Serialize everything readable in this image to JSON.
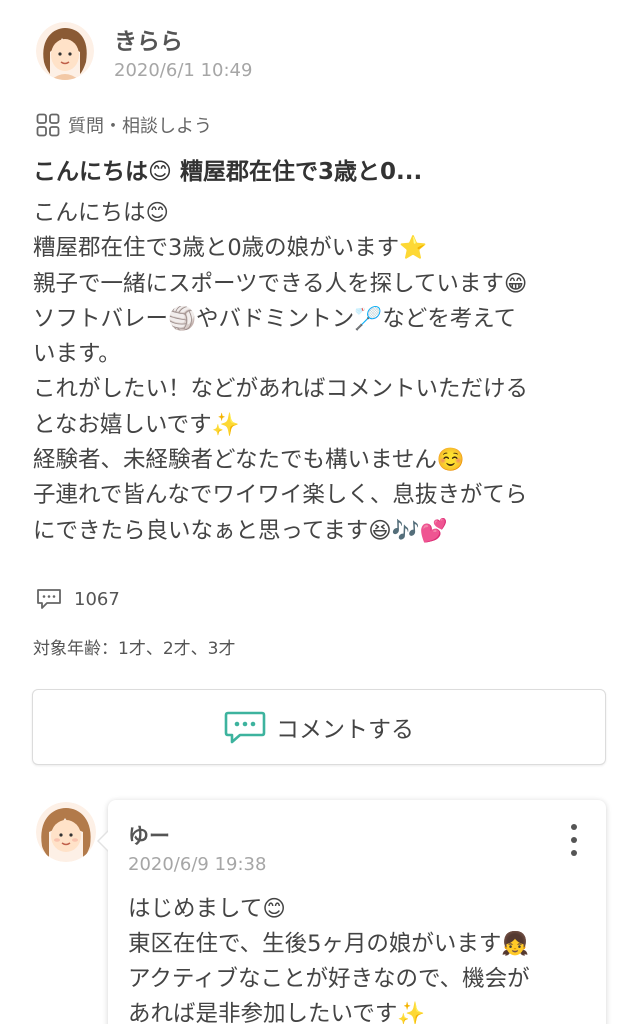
{
  "post": {
    "author": "きらら",
    "date": "2020/6/1 10:49",
    "category": "質問・相談しよう",
    "title": "こんにちは😊 糟屋郡在住で3歳と0...",
    "body_lines": [
      "こんにちは😊",
      "糟屋郡在住で3歳と0歳の娘がいます⭐",
      "親子で一緒にスポーツできる人を探しています😁",
      "ソフトバレー🏐やバドミントン🏸などを考えて",
      "います。",
      "これがしたい！などがあればコメントいただける",
      "となお嬉しいです✨",
      "経験者、未経験者どなたでも構いません☺️",
      "子連れで皆んなでワイワイ楽しく、息抜きがてら",
      "にできたら良いなぁと思ってます😆🎶💕"
    ],
    "comment_count": "1067",
    "target_age": "対象年齢：1才、2才、3才"
  },
  "comment_button": {
    "label": "コメントする"
  },
  "reply": {
    "author": "ゆー",
    "date": "2020/6/9 19:38",
    "body_lines": [
      "はじめまして😊",
      "東区在住で、生後5ヶ月の娘がいます👧",
      "アクティブなことが好きなので、機会が",
      "あれば是非参加したいです✨"
    ]
  },
  "icons": {
    "category": "grid-icon",
    "comment_count": "speech-bubble-icon",
    "comment_button": "chat-bubble-icon",
    "reply_menu": "more-vertical-icon"
  },
  "colors": {
    "accent": "#3db39e",
    "muted_text": "#a6a6a6",
    "text": "#444444"
  }
}
